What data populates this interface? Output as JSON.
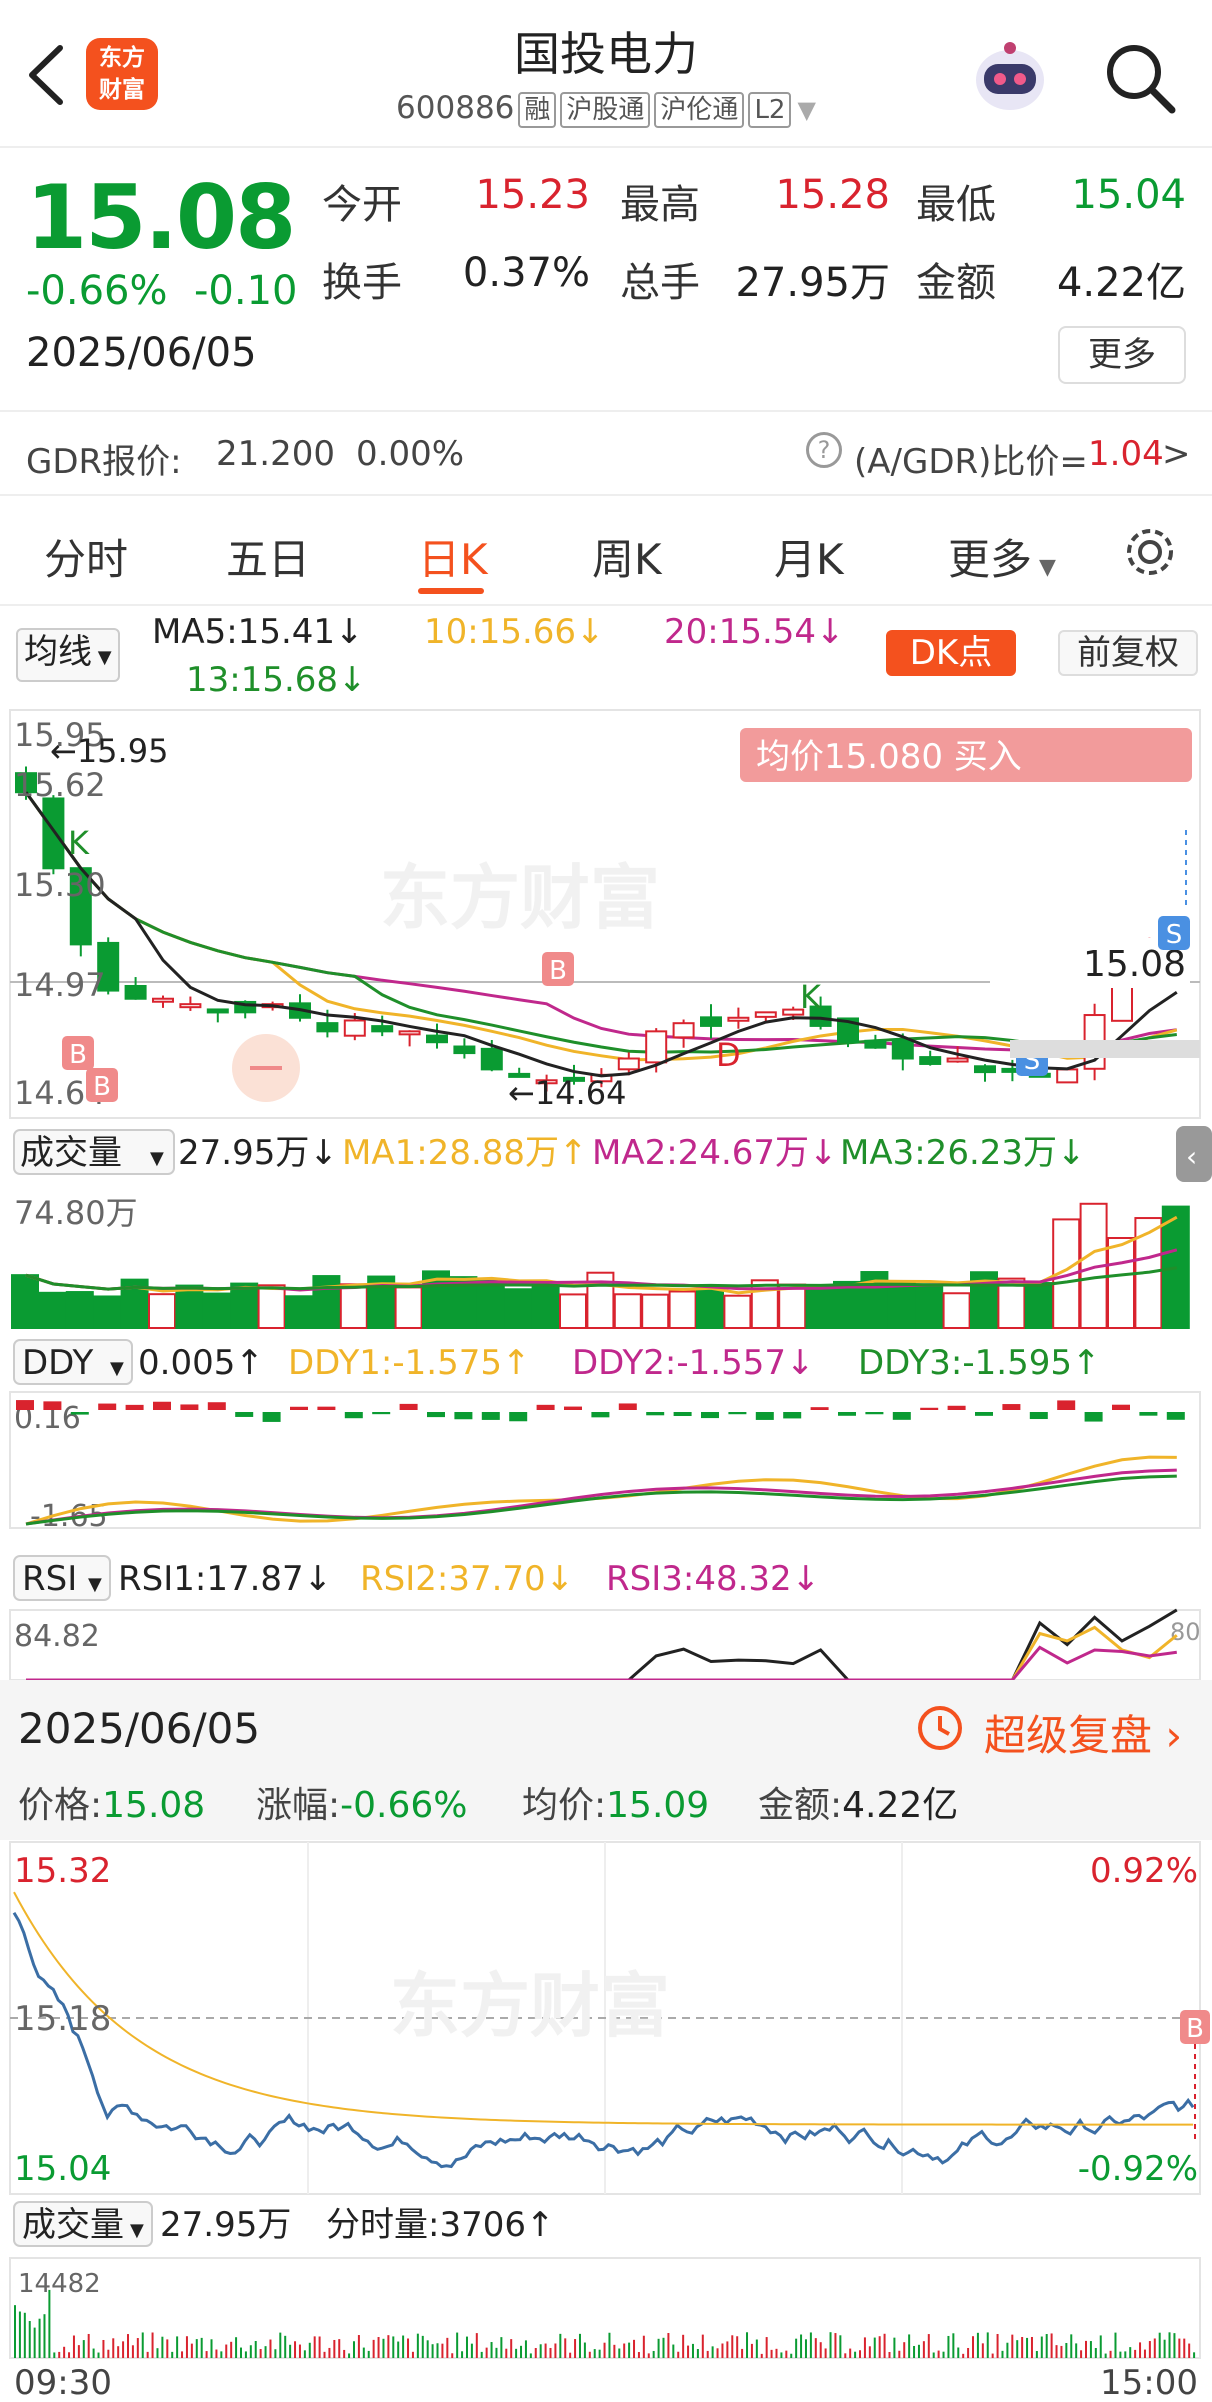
{
  "header": {
    "logo_text": "东方\n财富",
    "logo_line1": "东方",
    "logo_line2": "财富",
    "title": "国投电力",
    "code": "600886",
    "tags": [
      "融",
      "沪股通",
      "沪伦通",
      "L2"
    ]
  },
  "quote": {
    "price": "15.08",
    "change_pct": "-0.66%",
    "change": "-0.10",
    "date": "2025/06/05",
    "open_label": "今开",
    "open": "15.23",
    "high_label": "最高",
    "high": "15.28",
    "low_label": "最低",
    "low": "15.04",
    "turnover_label": "换手",
    "turnover": "0.37%",
    "volume_label": "总手",
    "volume": "27.95万",
    "amount_label": "金额",
    "amount": "4.22亿",
    "more_label": "更多"
  },
  "gdr": {
    "label": "GDR报价:",
    "price": "21.200",
    "pct": "0.00%",
    "ratio_label": "(A/GDR)比价=",
    "ratio": "1.04",
    "arrow": ">"
  },
  "tabs": [
    "分时",
    "五日",
    "日K",
    "周K",
    "月K",
    "更多"
  ],
  "ma_bar": {
    "select": "均线",
    "ma5": "MA5:15.41↓",
    "ma10": "10:15.66↓",
    "ma20": "20:15.54↓",
    "ma13": "13:15.68↓",
    "dk": "DK点",
    "fq": "前复权"
  },
  "kline": {
    "ymax": "15.95",
    "y2": "15.62",
    "y3": "15.30",
    "y4": "14.97",
    "ymin": "14.64",
    "hi_label": "15.95",
    "lo_label": "14.64",
    "last": "15.08",
    "avg_banner": "均价15.080  买入",
    "watermark": "东方财富",
    "b": "B",
    "s": "S",
    "k": "K",
    "d": "D"
  },
  "volume": {
    "select": "成交量",
    "value": "27.95万↓",
    "ma1": "MA1:28.88万↑",
    "ma2": "MA2:24.67万↓",
    "ma3": "MA3:26.23万↓",
    "ymax": "74.80万"
  },
  "ddy": {
    "select": "DDY",
    "value": "0.005↑",
    "ddy1": "DDY1:-1.575↑",
    "ddy2": "DDY2:-1.557↓",
    "ddy3": "DDY3:-1.595↑",
    "ymax": "0.16",
    "ymin": "-1.65"
  },
  "rsi": {
    "select": "RSI",
    "rsi1": "RSI1:17.87↓",
    "rsi2": "RSI2:37.70↓",
    "rsi3": "RSI3:48.32↓",
    "ymax": "84.82",
    "right": "80"
  },
  "intraday": {
    "date": "2025/06/05",
    "replay": "超级复盘",
    "price_label": "价格:",
    "price": "15.08",
    "chg_label": "涨幅:",
    "chg": "-0.66%",
    "avg_label": "均价:",
    "avg": "15.09",
    "amt_label": "金额:",
    "amt": "4.22亿",
    "ymax": "15.32",
    "ymid": "15.18",
    "ymin": "15.04",
    "pmax": "0.92%",
    "pmin": "-0.92%",
    "vol_select": "成交量",
    "vol": "27.95万",
    "tick_label": "分时量:",
    "tick": "3706↑",
    "vol_max": "14482",
    "t_start": "09:30",
    "t_end": "15:00",
    "b": "B"
  },
  "colors": {
    "up": "#d9232e",
    "down": "#0a9b32",
    "accent": "#f4511e",
    "ma5": "#222222",
    "ma10": "#f0b429",
    "ma20": "#c0288c",
    "ma13": "#1f8f2a"
  }
}
